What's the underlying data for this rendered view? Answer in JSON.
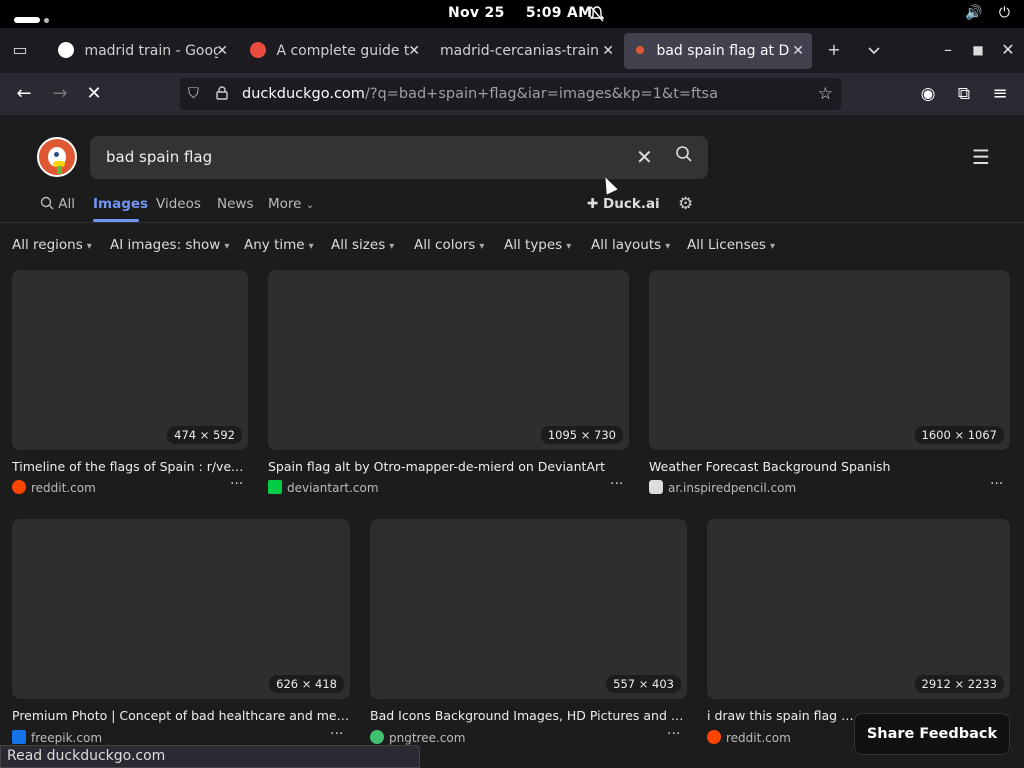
{
  "system_bar": {
    "date": "Nov 25",
    "time": "5:09 AM",
    "bell_icon": "bell-muted-icon",
    "volume_icon": "speaker-icon",
    "power_icon": "power-icon"
  },
  "tabs": [
    {
      "title": "madrid train - Googl",
      "favicon_color": "#4285f4",
      "active": false
    },
    {
      "title": "A complete guide to",
      "favicon_color": "#e94b3c",
      "active": false
    },
    {
      "title": "madrid-cercanias-trains",
      "favicon_color": "",
      "active": false
    },
    {
      "title": "bad spain flag at Du",
      "favicon_color": "#de5833",
      "active": true
    }
  ],
  "toolbar": {
    "new_tab": "+",
    "tab_list": "⌄",
    "back": "←",
    "forward": "→",
    "reload": "✕"
  },
  "url": {
    "host": "duckduckgo.com",
    "path": "/?q=bad+spain+flag&iar=images&kp=1&t=ftsa"
  },
  "search": {
    "query": "bad spain flag"
  },
  "nav_tabs": {
    "all": "All",
    "images": "Images",
    "videos": "Videos",
    "news": "News",
    "more": "More",
    "duck_ai": "Duck.ai"
  },
  "filters": [
    "All regions",
    "AI images: show",
    "Any time",
    "All sizes",
    "All colors",
    "All types",
    "All layouts",
    "All Licenses"
  ],
  "results": [
    {
      "dims": "474 × 592",
      "caption": "Timeline of the flags of Spain : r/vexillo...",
      "source": "reddit.com",
      "icon_color": "#ff4500"
    },
    {
      "dims": "1095 × 730",
      "caption": "Spain flag alt by Otro-mapper-de-mierd on DeviantArt",
      "source": "deviantart.com",
      "icon_color": "#05cc47"
    },
    {
      "dims": "1600 × 1067",
      "caption": "Weather Forecast Background Spanish",
      "source": "ar.inspiredpencil.com",
      "icon_color": "#dddddd"
    },
    {
      "dims": "626 × 418",
      "caption": "Premium Photo | Concept of bad healthcare and medicin...",
      "source": "freepik.com",
      "icon_color": "#1273eb"
    },
    {
      "dims": "557 × 403",
      "caption": "Bad Icons Background Images, HD Pictures and Wall...",
      "source": "pngtree.com",
      "icon_color": "#3fbf6f"
    },
    {
      "dims": "2912 × 2233",
      "caption": "i draw this spain flag in a",
      "source": "reddit.com",
      "icon_color": "#ff4500"
    }
  ],
  "more_label": "···",
  "feedback": "Share Feedback",
  "status": "Read duckduckgo.com"
}
